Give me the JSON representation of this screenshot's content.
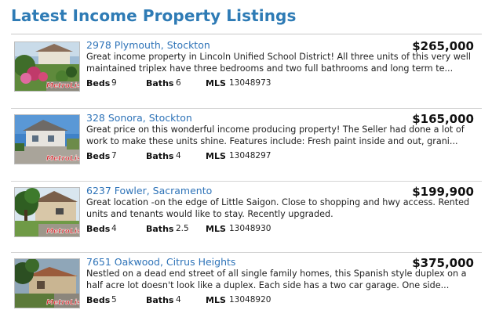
{
  "page": {
    "title": "Latest Income Property Listings"
  },
  "thumb_watermark": "MetroList",
  "stat_labels": {
    "beds": "Beds",
    "baths": "Baths",
    "mls": "MLS"
  },
  "colors": {
    "title": "#2e7bb5",
    "link": "#2e73b8",
    "watermark": "#d4262c"
  },
  "listings": [
    {
      "address": "2978 Plymouth, Stockton",
      "price": "$265,000",
      "description": "Great income property in Lincoln Unified School District! All three units of this very well maintained triplex have three bedrooms and two full bathrooms and long term te...",
      "beds": "9",
      "baths": "6",
      "mls": "13048973",
      "photo": "garden-triplex"
    },
    {
      "address": "328 Sonora, Stockton",
      "price": "$165,000",
      "description": "Great price on this wonderful income producing property! The Seller had done a lot of work to make these units shine. Features include: Fresh paint inside and out, grani...",
      "beds": "7",
      "baths": "4",
      "mls": "13048297",
      "photo": "house-sky"
    },
    {
      "address": "6237 Fowler, Sacramento",
      "price": "$199,900",
      "description": "Great location -on the edge of Little Saigon. Close to shopping and hwy access. Rented units and tenants would like to stay. Recently upgraded.",
      "beds": "4",
      "baths": "2.5",
      "mls": "13048930",
      "photo": "house-tree"
    },
    {
      "address": "7651 Oakwood, Citrus Heights",
      "price": "$375,000",
      "description": "Nestled on a dead end street of all single family homes, this Spanish style duplex on a half acre lot doesn't look like a duplex. Each side has a two car garage. One side...",
      "beds": "5",
      "baths": "4",
      "mls": "13048920",
      "photo": "spanish-duplex"
    }
  ]
}
